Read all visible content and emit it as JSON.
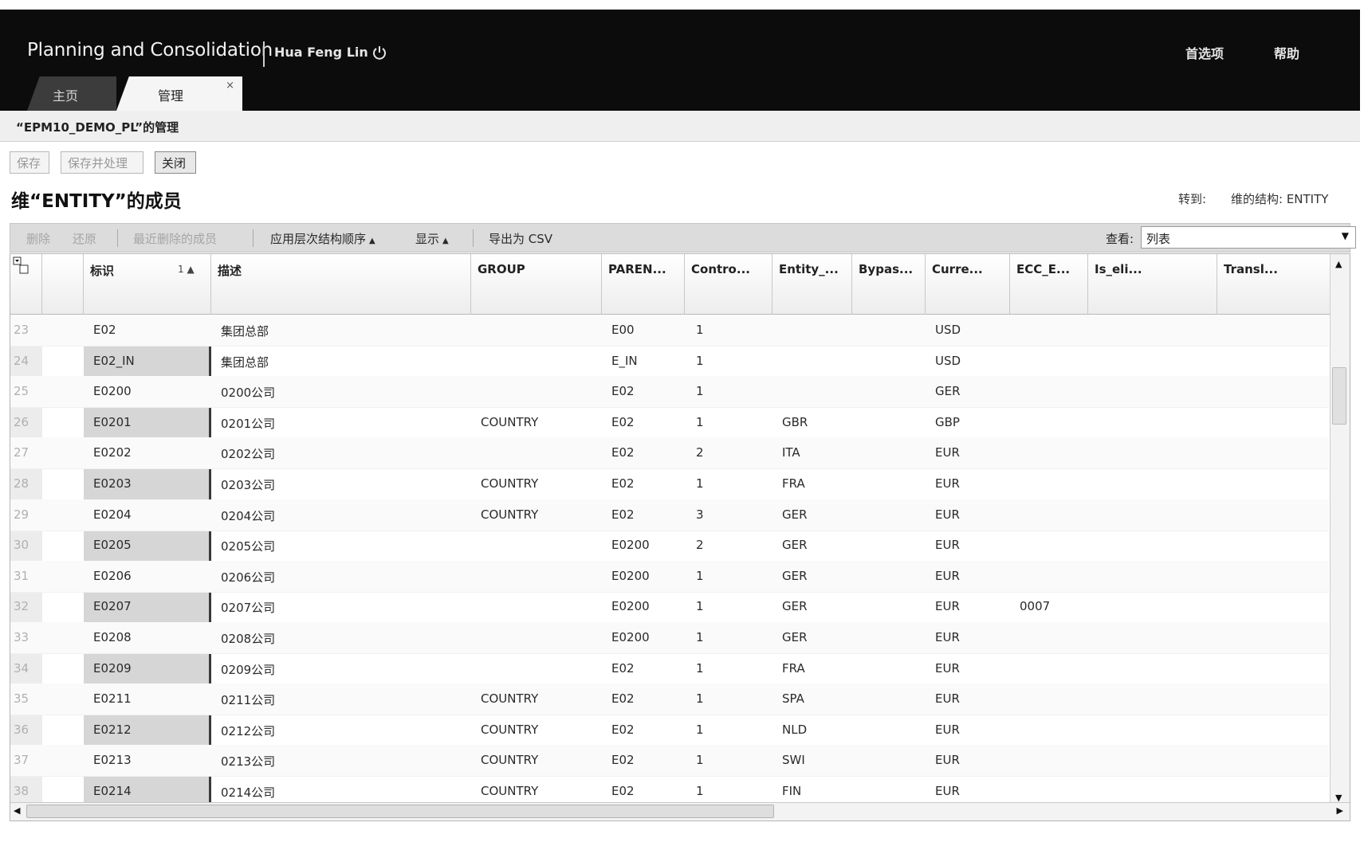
{
  "header": {
    "app_title": "Planning and Consolidation",
    "user_name": "Hua Feng Lin",
    "preferences_label": "首选项",
    "help_label": "帮助"
  },
  "tabs": [
    {
      "label": "主页"
    },
    {
      "label": "管理",
      "close": "×"
    }
  ],
  "page_subtitle": "“EPM10_DEMO_PL”的管理",
  "actions": {
    "save": "保存",
    "save_process": "保存并处理",
    "close": "关闭"
  },
  "section_title": "维“ENTITY”的成员",
  "goto": {
    "label": "转到:",
    "link": "维的结构: ENTITY"
  },
  "toolbar": {
    "delete": "删除",
    "restore": "还原",
    "recently_deleted": "最近删除的成员",
    "apply_hierarchy": "应用层次结构顺序",
    "display": "显示",
    "export_csv": "导出为 CSV",
    "view_label": "查看:",
    "view_value": "列表"
  },
  "columns": [
    {
      "key": "id",
      "label": "标识",
      "sort": "1 ▲"
    },
    {
      "key": "desc",
      "label": "描述"
    },
    {
      "key": "group",
      "label": "GROUP"
    },
    {
      "key": "parent",
      "label": "PAREN..."
    },
    {
      "key": "control",
      "label": "Contro..."
    },
    {
      "key": "entity",
      "label": "Entity_..."
    },
    {
      "key": "bypass",
      "label": "Bypas..."
    },
    {
      "key": "currency",
      "label": "Curre..."
    },
    {
      "key": "ecc",
      "label": "ECC_E..."
    },
    {
      "key": "is_elim",
      "label": "Is_eli..."
    },
    {
      "key": "transl",
      "label": "Transl..."
    }
  ],
  "rows": [
    {
      "n": "23",
      "id": "E02",
      "desc": "集团总部",
      "group": "",
      "parent": "E00",
      "control": "1",
      "entity": "",
      "bypass": "",
      "currency": "USD",
      "ecc": "",
      "is_elim": "",
      "transl": ""
    },
    {
      "n": "24",
      "id": "E02_IN",
      "desc": "集团总部",
      "group": "",
      "parent": "E_IN",
      "control": "1",
      "entity": "",
      "bypass": "",
      "currency": "USD",
      "ecc": "",
      "is_elim": "",
      "transl": ""
    },
    {
      "n": "25",
      "id": "E0200",
      "desc": "0200公司",
      "group": "",
      "parent": "E02",
      "control": "1",
      "entity": "",
      "bypass": "",
      "currency": "GER",
      "ecc": "",
      "is_elim": "",
      "transl": ""
    },
    {
      "n": "26",
      "id": "E0201",
      "desc": "0201公司",
      "group": "COUNTRY",
      "parent": "E02",
      "control": "1",
      "entity": "GBR",
      "bypass": "",
      "currency": "GBP",
      "ecc": "",
      "is_elim": "",
      "transl": ""
    },
    {
      "n": "27",
      "id": "E0202",
      "desc": "0202公司",
      "group": "",
      "parent": "E02",
      "control": "2",
      "entity": "ITA",
      "bypass": "",
      "currency": "EUR",
      "ecc": "",
      "is_elim": "",
      "transl": ""
    },
    {
      "n": "28",
      "id": "E0203",
      "desc": "0203公司",
      "group": "COUNTRY",
      "parent": "E02",
      "control": "1",
      "entity": "FRA",
      "bypass": "",
      "currency": "EUR",
      "ecc": "",
      "is_elim": "",
      "transl": ""
    },
    {
      "n": "29",
      "id": "E0204",
      "desc": "0204公司",
      "group": "COUNTRY",
      "parent": "E02",
      "control": "3",
      "entity": "GER",
      "bypass": "",
      "currency": "EUR",
      "ecc": "",
      "is_elim": "",
      "transl": ""
    },
    {
      "n": "30",
      "id": "E0205",
      "desc": "0205公司",
      "group": "",
      "parent": "E0200",
      "control": "2",
      "entity": "GER",
      "bypass": "",
      "currency": "EUR",
      "ecc": "",
      "is_elim": "",
      "transl": ""
    },
    {
      "n": "31",
      "id": "E0206",
      "desc": "0206公司",
      "group": "",
      "parent": "E0200",
      "control": "1",
      "entity": "GER",
      "bypass": "",
      "currency": "EUR",
      "ecc": "",
      "is_elim": "",
      "transl": ""
    },
    {
      "n": "32",
      "id": "E0207",
      "desc": "0207公司",
      "group": "",
      "parent": "E0200",
      "control": "1",
      "entity": "GER",
      "bypass": "",
      "currency": "EUR",
      "ecc": "0007",
      "is_elim": "",
      "transl": ""
    },
    {
      "n": "33",
      "id": "E0208",
      "desc": "0208公司",
      "group": "",
      "parent": "E0200",
      "control": "1",
      "entity": "GER",
      "bypass": "",
      "currency": "EUR",
      "ecc": "",
      "is_elim": "",
      "transl": ""
    },
    {
      "n": "34",
      "id": "E0209",
      "desc": "0209公司",
      "group": "",
      "parent": "E02",
      "control": "1",
      "entity": "FRA",
      "bypass": "",
      "currency": "EUR",
      "ecc": "",
      "is_elim": "",
      "transl": ""
    },
    {
      "n": "35",
      "id": "E0211",
      "desc": "0211公司",
      "group": "COUNTRY",
      "parent": "E02",
      "control": "1",
      "entity": "SPA",
      "bypass": "",
      "currency": "EUR",
      "ecc": "",
      "is_elim": "",
      "transl": ""
    },
    {
      "n": "36",
      "id": "E0212",
      "desc": "0212公司",
      "group": "COUNTRY",
      "parent": "E02",
      "control": "1",
      "entity": "NLD",
      "bypass": "",
      "currency": "EUR",
      "ecc": "",
      "is_elim": "",
      "transl": ""
    },
    {
      "n": "37",
      "id": "E0213",
      "desc": "0213公司",
      "group": "COUNTRY",
      "parent": "E02",
      "control": "1",
      "entity": "SWI",
      "bypass": "",
      "currency": "EUR",
      "ecc": "",
      "is_elim": "",
      "transl": ""
    },
    {
      "n": "38",
      "id": "E0214",
      "desc": "0214公司",
      "group": "COUNTRY",
      "parent": "E02",
      "control": "1",
      "entity": "FIN",
      "bypass": "",
      "currency": "EUR",
      "ecc": "",
      "is_elim": "",
      "transl": ""
    }
  ]
}
